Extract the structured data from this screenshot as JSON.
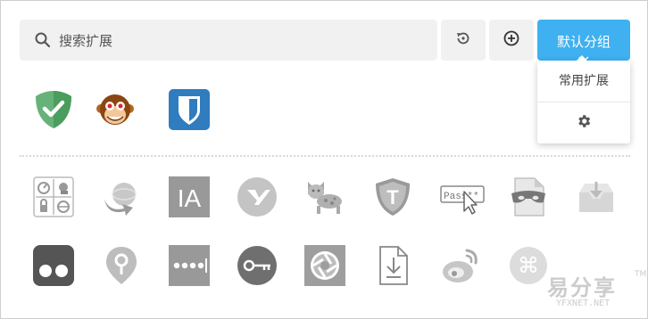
{
  "search": {
    "placeholder": "搜索扩展",
    "icon": "search-icon"
  },
  "toolbar": {
    "reset_icon": "reset-icon",
    "add_icon": "add-icon",
    "group_button": {
      "label": "默认分组",
      "accent": "#3fb0f0"
    }
  },
  "dropdown": {
    "items": [
      {
        "label": "常用扩展"
      },
      {
        "icon": "gear-icon"
      }
    ]
  },
  "enabled_extensions": [
    {
      "icon": "adguard-icon"
    },
    {
      "icon": "monkey-icon"
    },
    {
      "icon": "bitwarden-icon"
    }
  ],
  "disabled_extensions": [
    {
      "icon": "dashboard-icon"
    },
    {
      "icon": "globe-arrow-icon"
    },
    {
      "icon": "ia-icon",
      "text": "IA"
    },
    {
      "icon": "y-circle-icon"
    },
    {
      "icon": "tampermonkey-cat-icon"
    },
    {
      "icon": "t-shield-icon",
      "text": "T"
    },
    {
      "icon": "password-cursor-icon",
      "text": "Pass"
    },
    {
      "icon": "incognito-document-icon"
    },
    {
      "icon": "inbox-download-icon"
    },
    {
      "icon": "trello-toggle-icon"
    },
    {
      "icon": "keyhole-pin-icon"
    },
    {
      "icon": "dots-password-icon"
    },
    {
      "icon": "key-circle-icon"
    },
    {
      "icon": "aperture-icon"
    },
    {
      "icon": "doc-download-icon"
    },
    {
      "icon": "weibo-icon"
    },
    {
      "icon": "command-key-icon",
      "text": "⌘"
    }
  ],
  "watermark": {
    "text": "易分享",
    "sub": "YFXNET.NET",
    "tm": "TM"
  }
}
